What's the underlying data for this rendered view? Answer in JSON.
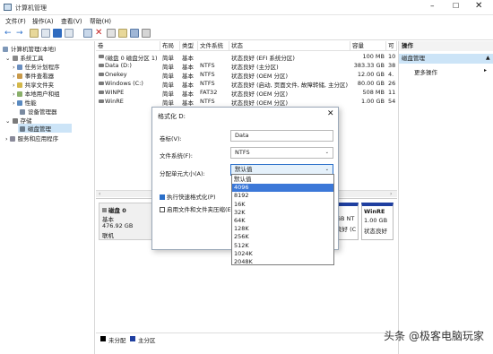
{
  "window": {
    "title": "计算机管理"
  },
  "menu": [
    "文件(F)",
    "操作(A)",
    "查看(V)",
    "帮助(H)"
  ],
  "tree": {
    "root": "计算机管理(本地)",
    "system_tools": "系统工具",
    "items": [
      "任务计划程序",
      "事件查看器",
      "共享文件夹",
      "本地用户和组",
      "性能",
      "设备管理器"
    ],
    "storage": "存储",
    "disk_mgmt": "磁盘管理",
    "services": "服务和应用程序"
  },
  "volumes": {
    "headers": [
      "卷",
      "布局",
      "类型",
      "文件系统",
      "状态",
      "容量",
      "可"
    ],
    "rows": [
      [
        "(磁盘 0 磁盘分区 1)",
        "简单",
        "基本",
        "",
        "状态良好 (EFI 系统分区)",
        "100 MB",
        "10"
      ],
      [
        "Data (D:)",
        "简单",
        "基本",
        "NTFS",
        "状态良好 (主分区)",
        "383.33 GB",
        "38"
      ],
      [
        "Onekey",
        "简单",
        "基本",
        "NTFS",
        "状态良好 (OEM 分区)",
        "12.00 GB",
        "4."
      ],
      [
        "Windows (C:)",
        "简单",
        "基本",
        "NTFS",
        "状态良好 (启动, 页面文件, 故障转储, 主分区)",
        "80.00 GB",
        "26"
      ],
      [
        "WINPE",
        "简单",
        "基本",
        "FAT32",
        "状态良好 (OEM 分区)",
        "508 MB",
        "11"
      ],
      [
        "WinRE",
        "简单",
        "基本",
        "NTFS",
        "状态良好 (OEM 分区)",
        "1.00 GB",
        "54"
      ]
    ]
  },
  "disk0": {
    "name": "磁盘 0",
    "type": "基本",
    "size": "476.92 GB",
    "status": "联机"
  },
  "disk_partitions": [
    {
      "title": "",
      "line1": "GB NT",
      "line2": "良好 (C"
    },
    {
      "title": "WinRE",
      "line1": "1.00 GB",
      "line2": "状态良好"
    }
  ],
  "legend": {
    "unallocated": "未分配",
    "primary": "主分区"
  },
  "actions": {
    "header": "操作",
    "section": "磁盘管理",
    "more": "更多操作"
  },
  "dialog": {
    "title": "格式化 D:",
    "label_volume": "卷标(V):",
    "value_volume": "Data",
    "label_fs": "文件系统(F):",
    "value_fs": "NTFS",
    "label_alloc": "分配单元大小(A):",
    "value_alloc": "默认值",
    "quick_format": "执行快速格式化(P)",
    "compress": "启用文件和文件夹压缩(E)"
  },
  "dropdown_options": [
    "默认值",
    "4096",
    "8192",
    "16K",
    "32K",
    "64K",
    "128K",
    "256K",
    "512K",
    "1024K",
    "2048K"
  ],
  "dropdown_selected_index": 1,
  "watermark": "头条 @极客电脑玩家",
  "colors": {
    "accent": "#cce4f7",
    "selection": "#3c78d8",
    "primary_partition": "#1f3fa0",
    "unallocated": "#000000"
  }
}
